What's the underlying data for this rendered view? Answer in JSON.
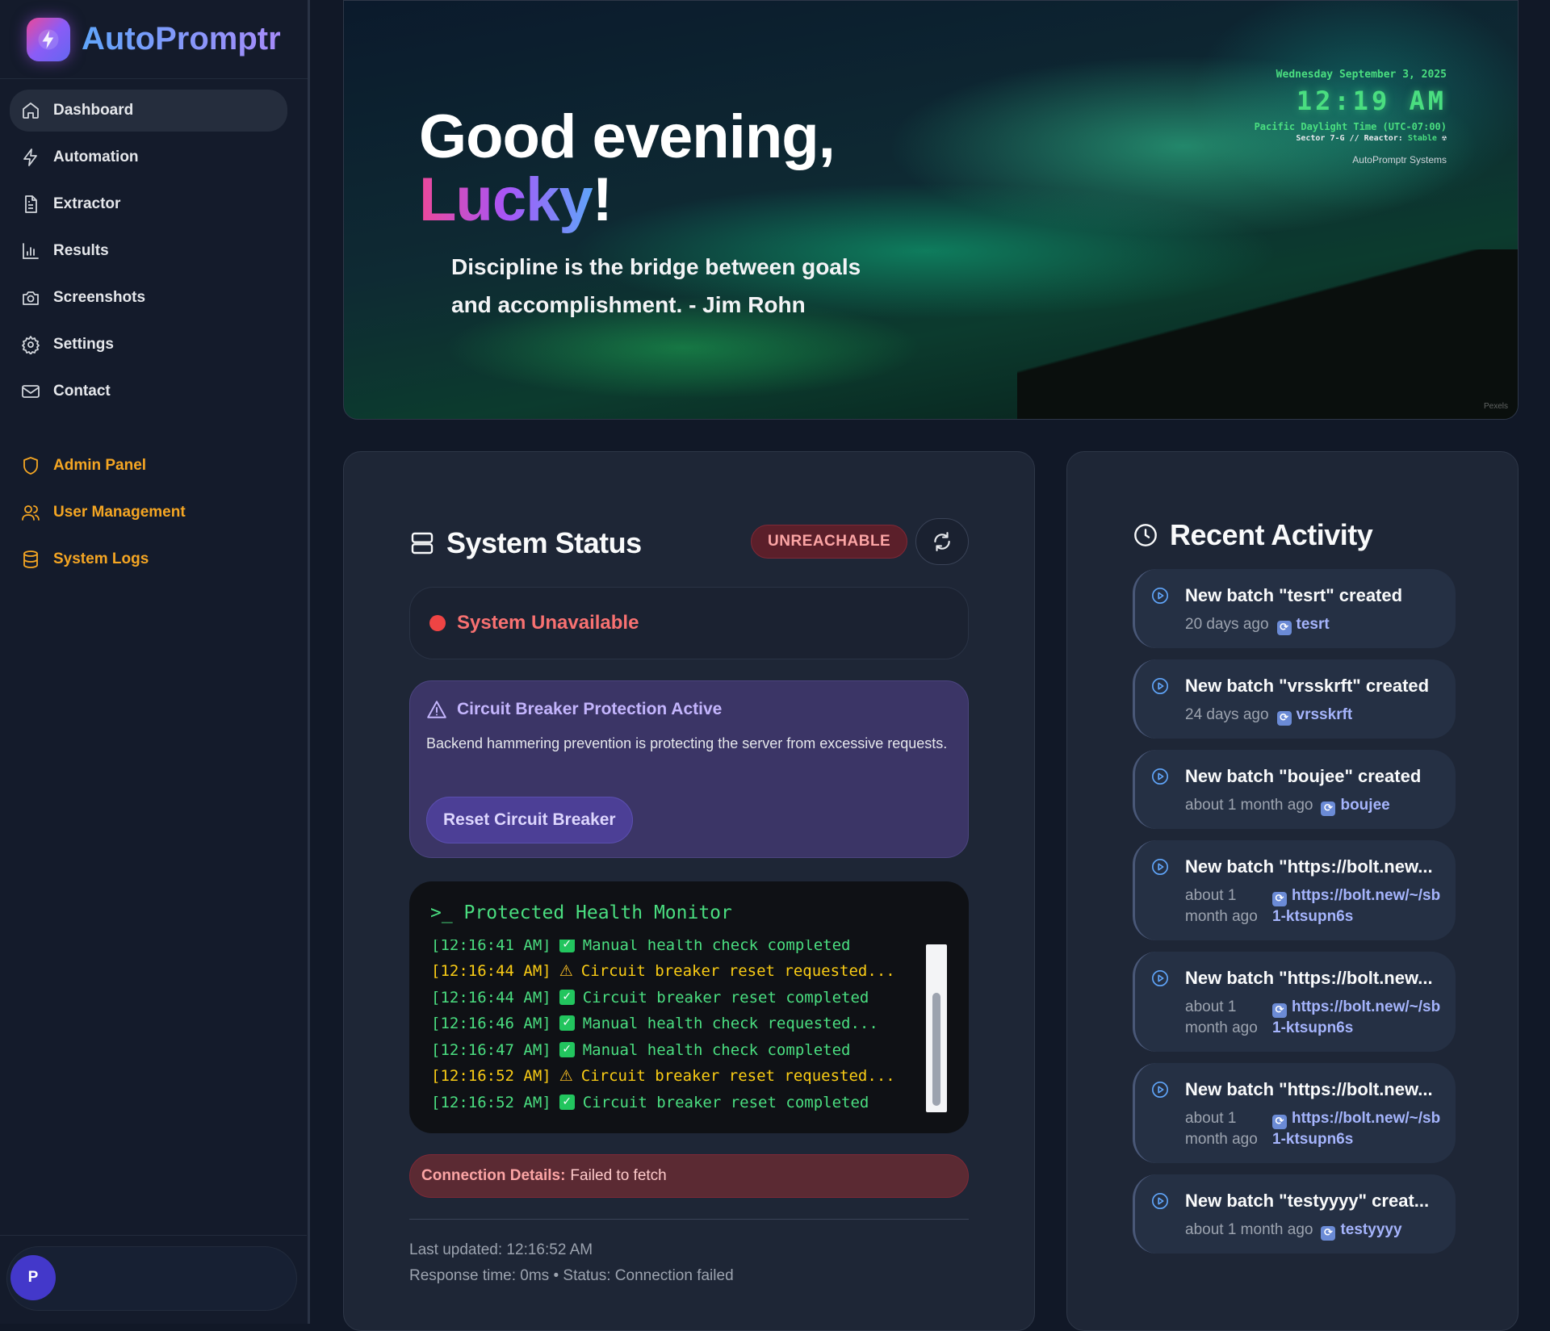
{
  "app": {
    "name": "AutoPromptr"
  },
  "sidebar": {
    "items": [
      {
        "label": "Dashboard",
        "icon": "home-icon"
      },
      {
        "label": "Automation",
        "icon": "bolt-icon"
      },
      {
        "label": "Extractor",
        "icon": "document-icon"
      },
      {
        "label": "Results",
        "icon": "bar-chart-icon"
      },
      {
        "label": "Screenshots",
        "icon": "camera-icon"
      },
      {
        "label": "Settings",
        "icon": "gear-icon"
      },
      {
        "label": "Contact",
        "icon": "mail-icon"
      }
    ],
    "admin_items": [
      {
        "label": "Admin Panel",
        "icon": "shield-icon"
      },
      {
        "label": "User Management",
        "icon": "users-icon"
      },
      {
        "label": "System Logs",
        "icon": "database-icon"
      }
    ],
    "user_initial": "P"
  },
  "hero": {
    "greeting": "Good evening,",
    "name": "Lucky",
    "exclaim": "!",
    "quote": "Discipline is the bridge between goals and accomplishment. - Jim Rohn",
    "clock": {
      "date": "Wednesday September 3, 2025",
      "time": "12:19 AM",
      "timezone": "Pacific Daylight Time (UTC-07:00)",
      "sector": "Sector 7-G  //  Reactor:",
      "reactor": "Stable",
      "company": "AutoPromptr Systems"
    },
    "credit": "Pexels"
  },
  "status": {
    "title": "System Status",
    "badge": "UNREACHABLE",
    "state": "System Unavailable",
    "breaker_title": "Circuit Breaker Protection Active",
    "breaker_text": "Backend hammering prevention is protecting the server from excessive requests.",
    "reset_label": "Reset Circuit Breaker",
    "monitor_title": ">_ Protected Health Monitor",
    "logs": [
      {
        "time": "[12:16:41 AM]",
        "kind": "ok",
        "msg": "Manual health check completed"
      },
      {
        "time": "[12:16:44 AM]",
        "kind": "warn",
        "msg": "Circuit breaker reset requested..."
      },
      {
        "time": "[12:16:44 AM]",
        "kind": "ok",
        "msg": "Circuit breaker reset completed"
      },
      {
        "time": "[12:16:46 AM]",
        "kind": "ok",
        "msg": "Manual health check requested..."
      },
      {
        "time": "[12:16:47 AM]",
        "kind": "ok",
        "msg": "Manual health check completed"
      },
      {
        "time": "[12:16:52 AM]",
        "kind": "warn",
        "msg": "Circuit breaker reset requested..."
      },
      {
        "time": "[12:16:52 AM]",
        "kind": "ok",
        "msg": "Circuit breaker reset completed"
      }
    ],
    "conn_label": "Connection Details:",
    "conn_value": "Failed to fetch",
    "last_updated": "Last updated: 12:16:52 AM",
    "response": "Response time: 0ms • Status: Connection failed",
    "colors": {
      "error": "#ef4444",
      "ok": "#4ade80",
      "warn": "#facc15"
    }
  },
  "activity": {
    "title": "Recent Activity",
    "items": [
      {
        "title": "New batch \"tesrt\" created",
        "ago": "20 days ago",
        "link": "tesrt",
        "long": false
      },
      {
        "title": "New batch \"vrsskrft\" created",
        "ago": "24 days ago",
        "link": "vrsskrft",
        "long": false
      },
      {
        "title": "New batch \"boujee\" created",
        "ago": "about 1 month ago",
        "link": "boujee",
        "long": false
      },
      {
        "title": "New batch \"https://bolt.new...",
        "ago": "about 1 month ago",
        "link": "https://bolt.new/~/sb1-ktsupn6s",
        "long": true
      },
      {
        "title": "New batch \"https://bolt.new...",
        "ago": "about 1 month ago",
        "link": "https://bolt.new/~/sb1-ktsupn6s",
        "long": true
      },
      {
        "title": "New batch \"https://bolt.new...",
        "ago": "about 1 month ago",
        "link": "https://bolt.new/~/sb1-ktsupn6s",
        "long": true
      },
      {
        "title": "New batch \"testyyyy\" creat...",
        "ago": "about 1 month ago",
        "link": "testyyyy",
        "long": false
      }
    ]
  }
}
